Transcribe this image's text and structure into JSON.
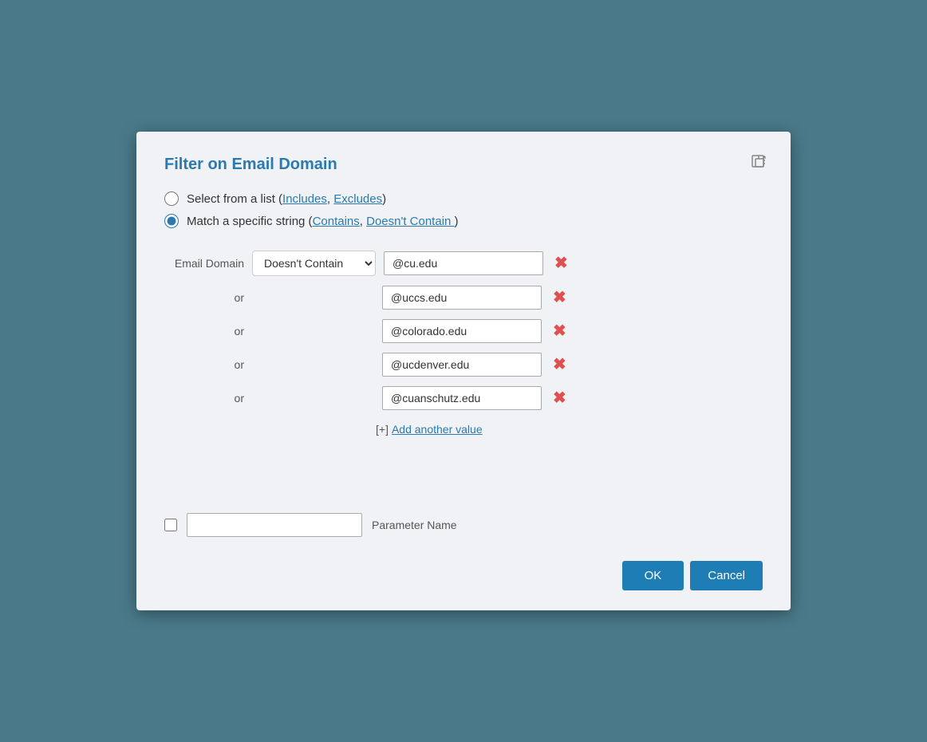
{
  "dialog": {
    "title": "Filter on Email Domain",
    "export_icon": "export-icon",
    "radio_options": [
      {
        "id": "select-list",
        "label": "Select from a list ",
        "links": [
          "Includes",
          "Excludes"
        ],
        "checked": false
      },
      {
        "id": "match-string",
        "label": "Match a specific string ",
        "links": [
          "Contains",
          "Doesn't Contain "
        ],
        "checked": true
      }
    ],
    "filter_label": "Email Domain",
    "condition_options": [
      "Contains",
      "Doesn't Contain"
    ],
    "condition_selected": "Doesn't Contain",
    "values": [
      "@cu.edu",
      "@uccs.edu",
      "@colorado.edu",
      "@ucdenver.edu",
      "@cuanschutz.edu"
    ],
    "or_label": "or",
    "add_value_text": "[+]",
    "add_value_link": "Add another value",
    "parameter_name_label": "Parameter Name",
    "buttons": {
      "ok": "OK",
      "cancel": "Cancel"
    },
    "colors": {
      "accent": "#2a7ab0",
      "remove": "#e05050"
    }
  }
}
